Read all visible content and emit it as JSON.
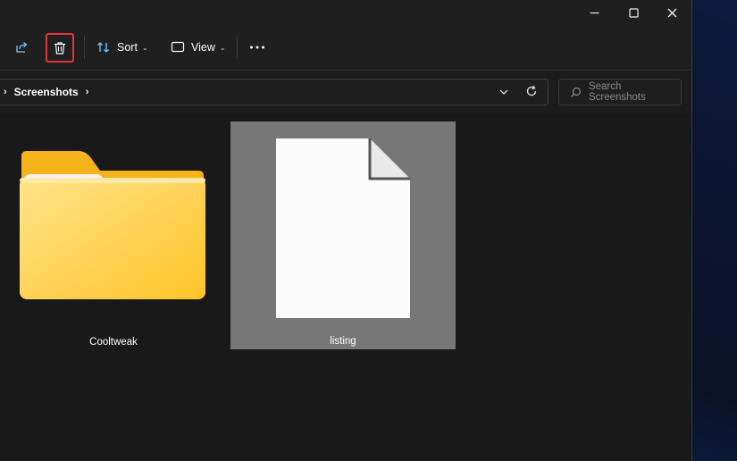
{
  "toolbar": {
    "sort_label": "Sort",
    "view_label": "View"
  },
  "address": {
    "crumbs": [
      "Screenshots"
    ]
  },
  "search": {
    "placeholder": "Search Screenshots"
  },
  "files": [
    {
      "name": "Cooltweak",
      "type": "folder",
      "selected": false
    },
    {
      "name": "listing",
      "type": "file",
      "selected": true
    }
  ],
  "colors": {
    "highlight_border": "#e0353f",
    "selected_bg": "#777777",
    "folder_yellow": "#ffc83d",
    "window_bg": "#191919"
  },
  "icons": [
    "share-icon",
    "delete-icon",
    "sort-icon",
    "view-icon",
    "more-icon",
    "chevron-down-icon",
    "refresh-icon",
    "search-icon",
    "minimize-icon",
    "maximize-icon",
    "close-icon"
  ]
}
